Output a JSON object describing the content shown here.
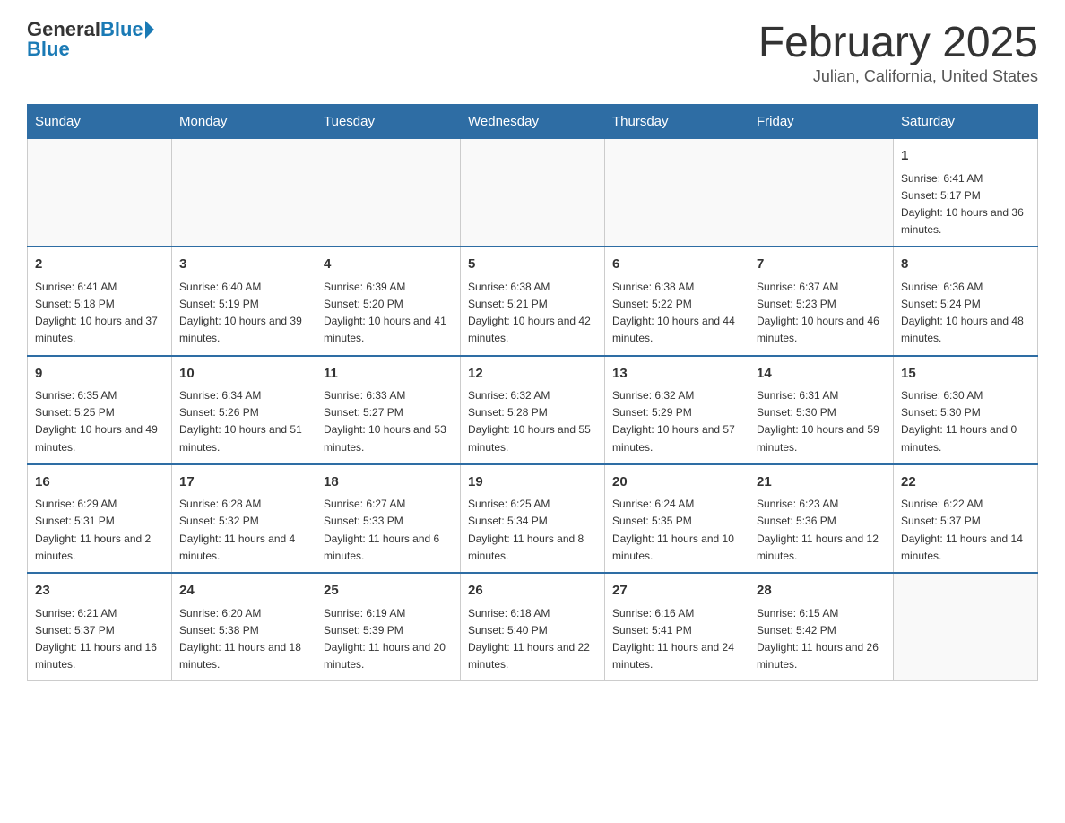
{
  "header": {
    "logo_general": "General",
    "logo_blue": "Blue",
    "month_title": "February 2025",
    "location": "Julian, California, United States"
  },
  "weekdays": [
    "Sunday",
    "Monday",
    "Tuesday",
    "Wednesday",
    "Thursday",
    "Friday",
    "Saturday"
  ],
  "weeks": [
    {
      "days": [
        {
          "num": "",
          "info": ""
        },
        {
          "num": "",
          "info": ""
        },
        {
          "num": "",
          "info": ""
        },
        {
          "num": "",
          "info": ""
        },
        {
          "num": "",
          "info": ""
        },
        {
          "num": "",
          "info": ""
        },
        {
          "num": "1",
          "info": "Sunrise: 6:41 AM\nSunset: 5:17 PM\nDaylight: 10 hours and 36 minutes."
        }
      ]
    },
    {
      "days": [
        {
          "num": "2",
          "info": "Sunrise: 6:41 AM\nSunset: 5:18 PM\nDaylight: 10 hours and 37 minutes."
        },
        {
          "num": "3",
          "info": "Sunrise: 6:40 AM\nSunset: 5:19 PM\nDaylight: 10 hours and 39 minutes."
        },
        {
          "num": "4",
          "info": "Sunrise: 6:39 AM\nSunset: 5:20 PM\nDaylight: 10 hours and 41 minutes."
        },
        {
          "num": "5",
          "info": "Sunrise: 6:38 AM\nSunset: 5:21 PM\nDaylight: 10 hours and 42 minutes."
        },
        {
          "num": "6",
          "info": "Sunrise: 6:38 AM\nSunset: 5:22 PM\nDaylight: 10 hours and 44 minutes."
        },
        {
          "num": "7",
          "info": "Sunrise: 6:37 AM\nSunset: 5:23 PM\nDaylight: 10 hours and 46 minutes."
        },
        {
          "num": "8",
          "info": "Sunrise: 6:36 AM\nSunset: 5:24 PM\nDaylight: 10 hours and 48 minutes."
        }
      ]
    },
    {
      "days": [
        {
          "num": "9",
          "info": "Sunrise: 6:35 AM\nSunset: 5:25 PM\nDaylight: 10 hours and 49 minutes."
        },
        {
          "num": "10",
          "info": "Sunrise: 6:34 AM\nSunset: 5:26 PM\nDaylight: 10 hours and 51 minutes."
        },
        {
          "num": "11",
          "info": "Sunrise: 6:33 AM\nSunset: 5:27 PM\nDaylight: 10 hours and 53 minutes."
        },
        {
          "num": "12",
          "info": "Sunrise: 6:32 AM\nSunset: 5:28 PM\nDaylight: 10 hours and 55 minutes."
        },
        {
          "num": "13",
          "info": "Sunrise: 6:32 AM\nSunset: 5:29 PM\nDaylight: 10 hours and 57 minutes."
        },
        {
          "num": "14",
          "info": "Sunrise: 6:31 AM\nSunset: 5:30 PM\nDaylight: 10 hours and 59 minutes."
        },
        {
          "num": "15",
          "info": "Sunrise: 6:30 AM\nSunset: 5:30 PM\nDaylight: 11 hours and 0 minutes."
        }
      ]
    },
    {
      "days": [
        {
          "num": "16",
          "info": "Sunrise: 6:29 AM\nSunset: 5:31 PM\nDaylight: 11 hours and 2 minutes."
        },
        {
          "num": "17",
          "info": "Sunrise: 6:28 AM\nSunset: 5:32 PM\nDaylight: 11 hours and 4 minutes."
        },
        {
          "num": "18",
          "info": "Sunrise: 6:27 AM\nSunset: 5:33 PM\nDaylight: 11 hours and 6 minutes."
        },
        {
          "num": "19",
          "info": "Sunrise: 6:25 AM\nSunset: 5:34 PM\nDaylight: 11 hours and 8 minutes."
        },
        {
          "num": "20",
          "info": "Sunrise: 6:24 AM\nSunset: 5:35 PM\nDaylight: 11 hours and 10 minutes."
        },
        {
          "num": "21",
          "info": "Sunrise: 6:23 AM\nSunset: 5:36 PM\nDaylight: 11 hours and 12 minutes."
        },
        {
          "num": "22",
          "info": "Sunrise: 6:22 AM\nSunset: 5:37 PM\nDaylight: 11 hours and 14 minutes."
        }
      ]
    },
    {
      "days": [
        {
          "num": "23",
          "info": "Sunrise: 6:21 AM\nSunset: 5:37 PM\nDaylight: 11 hours and 16 minutes."
        },
        {
          "num": "24",
          "info": "Sunrise: 6:20 AM\nSunset: 5:38 PM\nDaylight: 11 hours and 18 minutes."
        },
        {
          "num": "25",
          "info": "Sunrise: 6:19 AM\nSunset: 5:39 PM\nDaylight: 11 hours and 20 minutes."
        },
        {
          "num": "26",
          "info": "Sunrise: 6:18 AM\nSunset: 5:40 PM\nDaylight: 11 hours and 22 minutes."
        },
        {
          "num": "27",
          "info": "Sunrise: 6:16 AM\nSunset: 5:41 PM\nDaylight: 11 hours and 24 minutes."
        },
        {
          "num": "28",
          "info": "Sunrise: 6:15 AM\nSunset: 5:42 PM\nDaylight: 11 hours and 26 minutes."
        },
        {
          "num": "",
          "info": ""
        }
      ]
    }
  ]
}
